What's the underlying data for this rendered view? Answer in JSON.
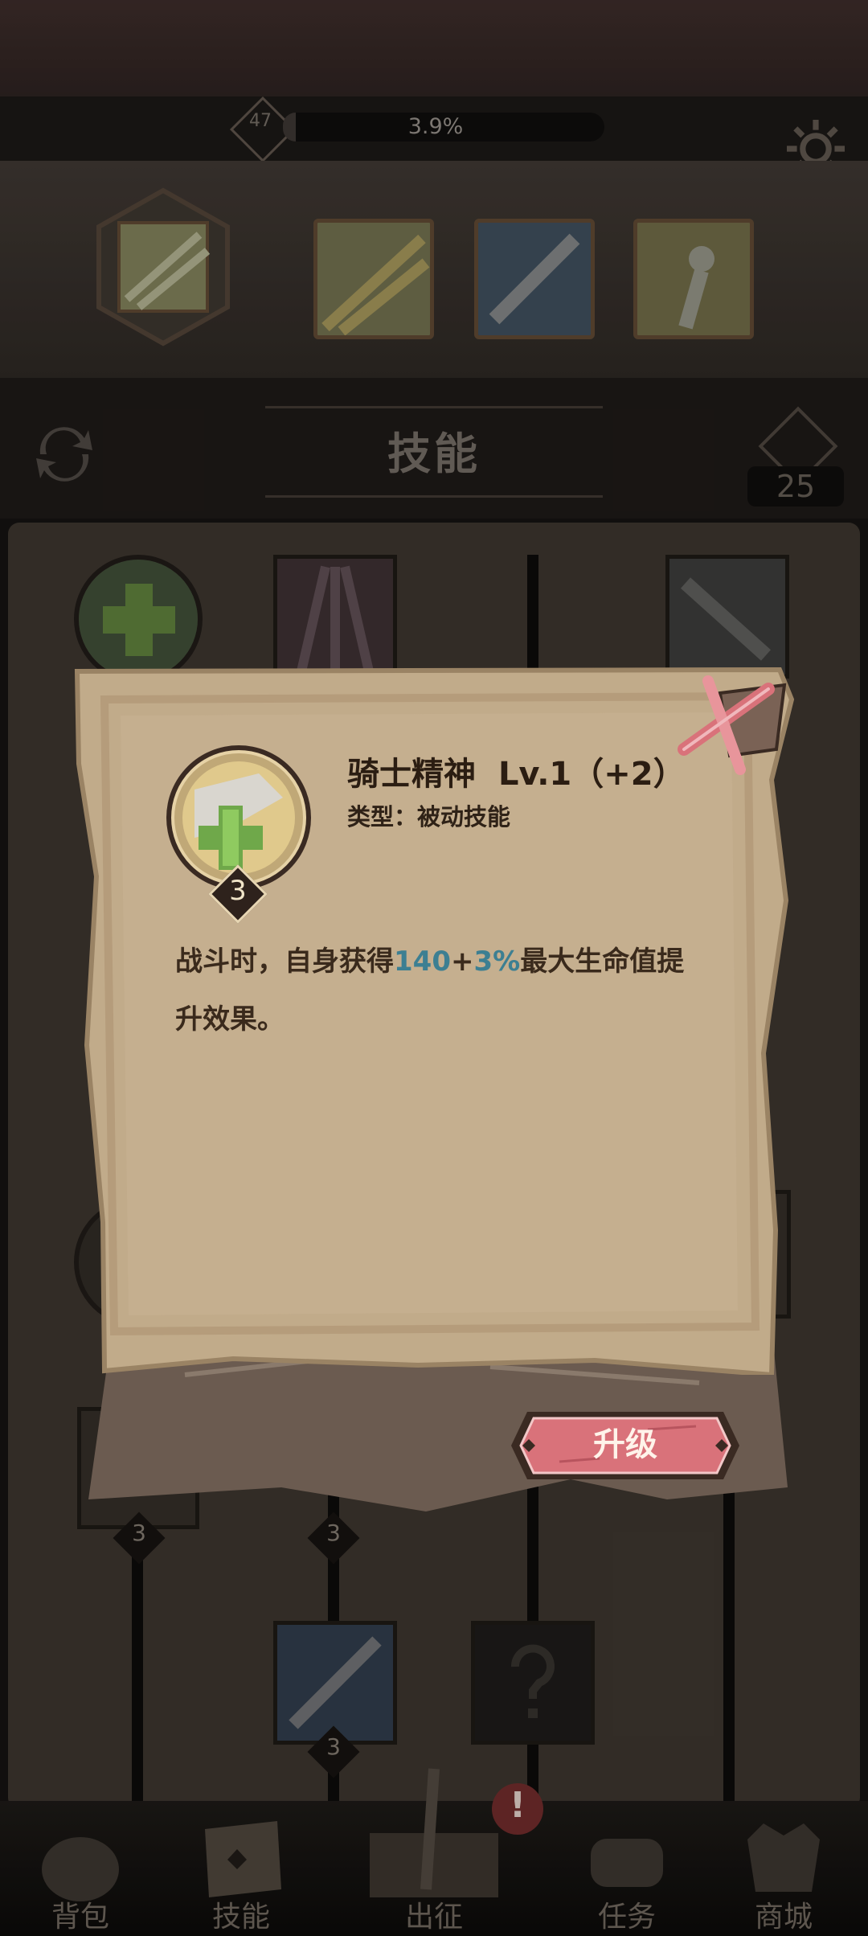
{
  "header": {
    "level": "47",
    "progress_text": "3.9%",
    "progress": 0.039,
    "settings_icon": "gear-icon"
  },
  "page": {
    "title": "技能",
    "skill_points": "25"
  },
  "tree": {
    "badges": [
      "3",
      "3",
      "3"
    ]
  },
  "nav": {
    "items": [
      {
        "label": "背包",
        "icon": "bag-icon"
      },
      {
        "label": "技能",
        "icon": "book-icon"
      },
      {
        "label": "出征",
        "icon": "sword-icon"
      },
      {
        "label": "任务",
        "icon": "scroll-icon"
      },
      {
        "label": "商城",
        "icon": "shop-icon"
      }
    ],
    "alert": "!"
  },
  "dialog": {
    "skill_name": "骑士精神",
    "skill_level": "Lv.1（+2）",
    "type_label": "类型：",
    "type_value": "被动技能",
    "icon_badge": "3",
    "desc_prefix": "战斗时，自身获得",
    "desc_value1": "140",
    "desc_plus": "+",
    "desc_value2": "3%",
    "desc_suffix": "最大生命值提升效果。",
    "upgrade_label": "升级",
    "highlight_color": "#3c7f92",
    "button_color": "#d9727a"
  }
}
